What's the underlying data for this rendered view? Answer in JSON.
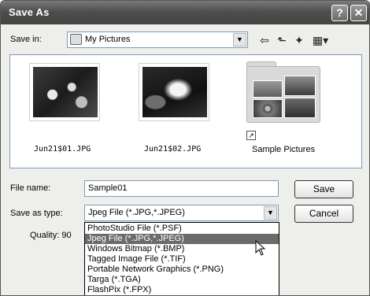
{
  "dialog": {
    "title": "Save As",
    "help_glyph": "?",
    "close_glyph": "✕"
  },
  "save_in": {
    "label": "Save in:",
    "value": "My Pictures",
    "dropdown_glyph": "▼"
  },
  "toolbar": {
    "back_glyph": "⇦",
    "up_glyph": "⬑",
    "new_folder_glyph": "✦",
    "view_menu_glyph": "▦▾"
  },
  "files": [
    {
      "name": "Jun21$01.JPG",
      "icon": "photo-thumbnail"
    },
    {
      "name": "Jun21$02.JPG",
      "icon": "photo-thumbnail"
    },
    {
      "name": "Sample Pictures",
      "icon": "folder-shortcut"
    }
  ],
  "shortcut_glyph": "↗",
  "file_name": {
    "label": "File name:",
    "value": "Sample01"
  },
  "save_as_type": {
    "label": "Save as type:",
    "value": "Jpeg File (*.JPG,*.JPEG)",
    "dropdown_glyph": "▼",
    "options": [
      "PhotoStudio File (*.PSF)",
      "Jpeg File (*.JPG,*.JPEG)",
      "Windows Bitmap (*.BMP)",
      "Tagged Image File (*.TIF)",
      "Portable Network Graphics (*.PNG)",
      "Targa (*.TGA)",
      "FlashPix (*.FPX)"
    ],
    "highlighted_index": 1
  },
  "quality": {
    "label": "Quality: 90"
  },
  "buttons": {
    "save": "Save",
    "cancel": "Cancel"
  },
  "colors": {
    "titlebar": "#4e4e4e",
    "selection": "#6b6b6b",
    "field_border": "#7f9db9"
  }
}
